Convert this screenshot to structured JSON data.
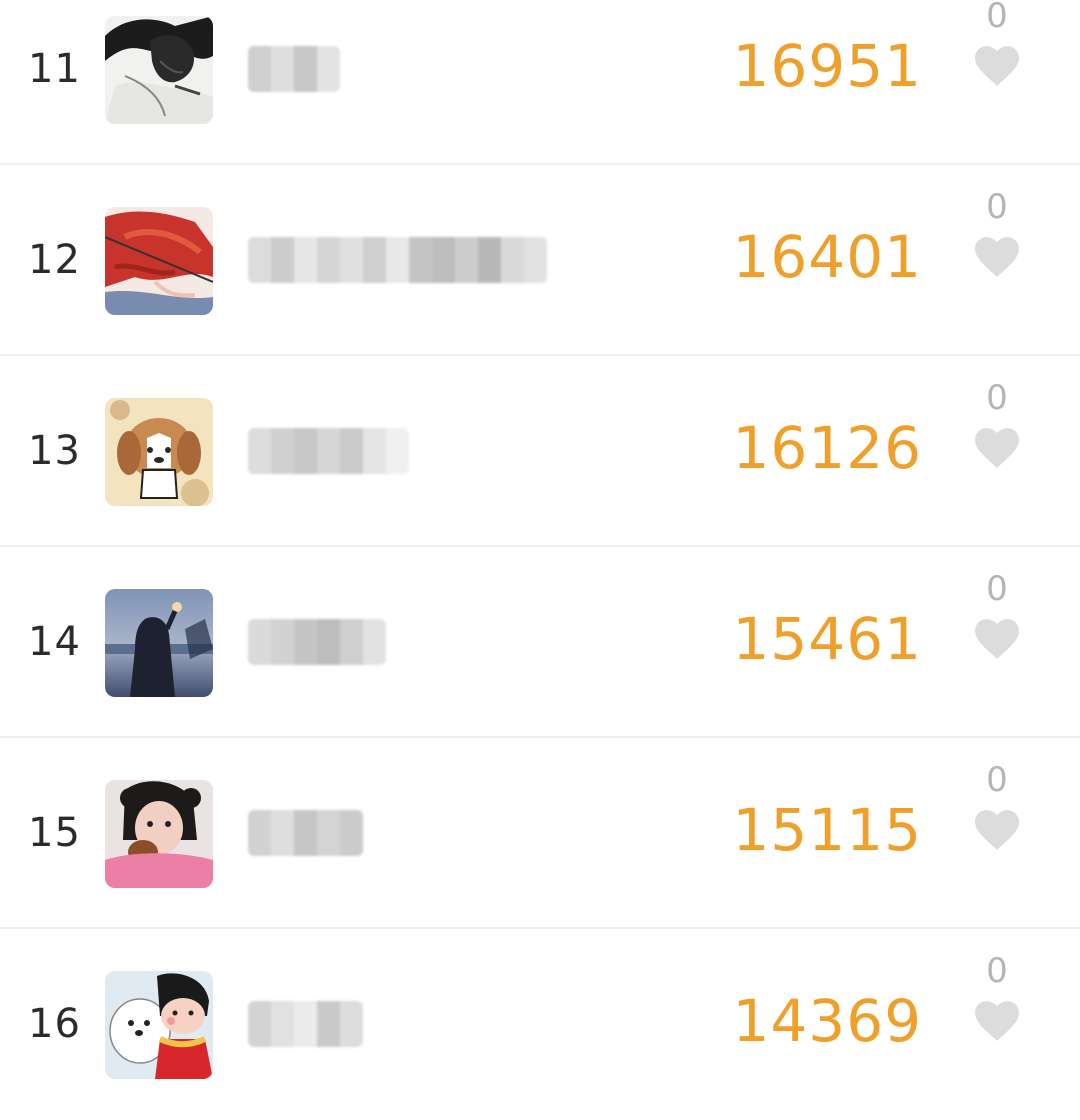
{
  "colors": {
    "score": "#f0a02a",
    "rank": "#2b2b2b",
    "like_count": "#b5b5b5",
    "heart": "#dcdcdc",
    "divider": "#eeeeee"
  },
  "leaderboard": {
    "rows": [
      {
        "rank": "11",
        "score": "16951",
        "likes": "0",
        "like_icon": "heart-icon"
      },
      {
        "rank": "12",
        "score": "16401",
        "likes": "0",
        "like_icon": "heart-icon"
      },
      {
        "rank": "13",
        "score": "16126",
        "likes": "0",
        "like_icon": "heart-icon"
      },
      {
        "rank": "14",
        "score": "15461",
        "likes": "0",
        "like_icon": "heart-icon"
      },
      {
        "rank": "15",
        "score": "15115",
        "likes": "0",
        "like_icon": "heart-icon"
      },
      {
        "rank": "16",
        "score": "14369",
        "likes": "0",
        "like_icon": "heart-icon"
      }
    ]
  }
}
